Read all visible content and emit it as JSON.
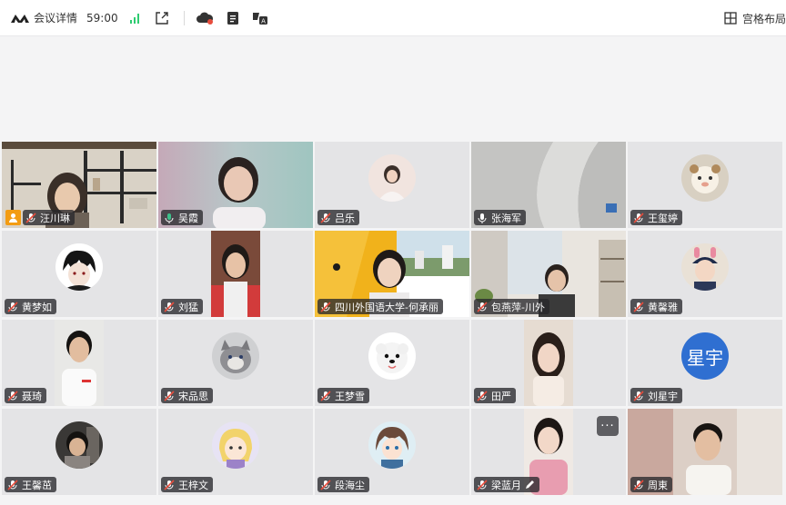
{
  "topbar": {
    "meeting_label": "会议详情",
    "timer": "59:00",
    "layout_label": "宫格布局"
  },
  "participants": [
    {
      "name": "汪川琳",
      "host": true
    },
    {
      "name": "吴霞",
      "speaking": true
    },
    {
      "name": "吕乐"
    },
    {
      "name": "张海军"
    },
    {
      "name": "王玺婷"
    },
    {
      "name": "黄梦如"
    },
    {
      "name": "刘猛"
    },
    {
      "name": "四川外国语大学-何承丽"
    },
    {
      "name": "包燕萍-川外"
    },
    {
      "name": "黄馨雅"
    },
    {
      "name": "聂琦"
    },
    {
      "name": "宋品思"
    },
    {
      "name": "王梦雪"
    },
    {
      "name": "田严"
    },
    {
      "name": "刘星宇",
      "avatar_text": "星宇"
    },
    {
      "name": "王馨茁"
    },
    {
      "name": "王梓文"
    },
    {
      "name": "段海尘"
    },
    {
      "name": "梁蓝月"
    },
    {
      "name": "周東"
    }
  ],
  "more_label": "···",
  "colors": {
    "active_border": "#3cc08a",
    "signal": "#2ecc71",
    "host_badge": "#f39c12",
    "avatar_blue": "#2f6fd1"
  }
}
